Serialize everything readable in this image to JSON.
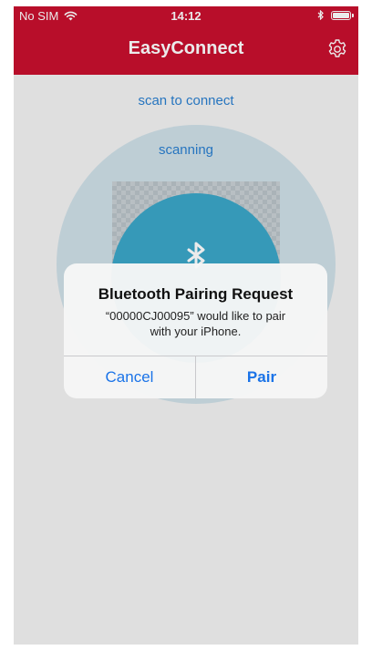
{
  "status_bar": {
    "carrier": "No SIM",
    "time": "14:12",
    "wifi_icon": "wifi-icon",
    "bluetooth_icon": "bluetooth-icon",
    "battery_icon": "battery-icon"
  },
  "navbar": {
    "title": "EasyConnect",
    "settings_icon": "gear-icon"
  },
  "scan": {
    "label": "scan to connect",
    "status": "scanning",
    "center_icon": "bluetooth-icon"
  },
  "alert": {
    "title": "Bluetooth Pairing Request",
    "message_line1": "“00000CJ00095” would like to pair",
    "message_line2": "with your iPhone.",
    "cancel_label": "Cancel",
    "pair_label": "Pair"
  },
  "colors": {
    "header": "#c8102e",
    "accent": "#1a73e8",
    "scan_text": "#2a7fd0",
    "bt_circle": "#3ba7c8"
  }
}
